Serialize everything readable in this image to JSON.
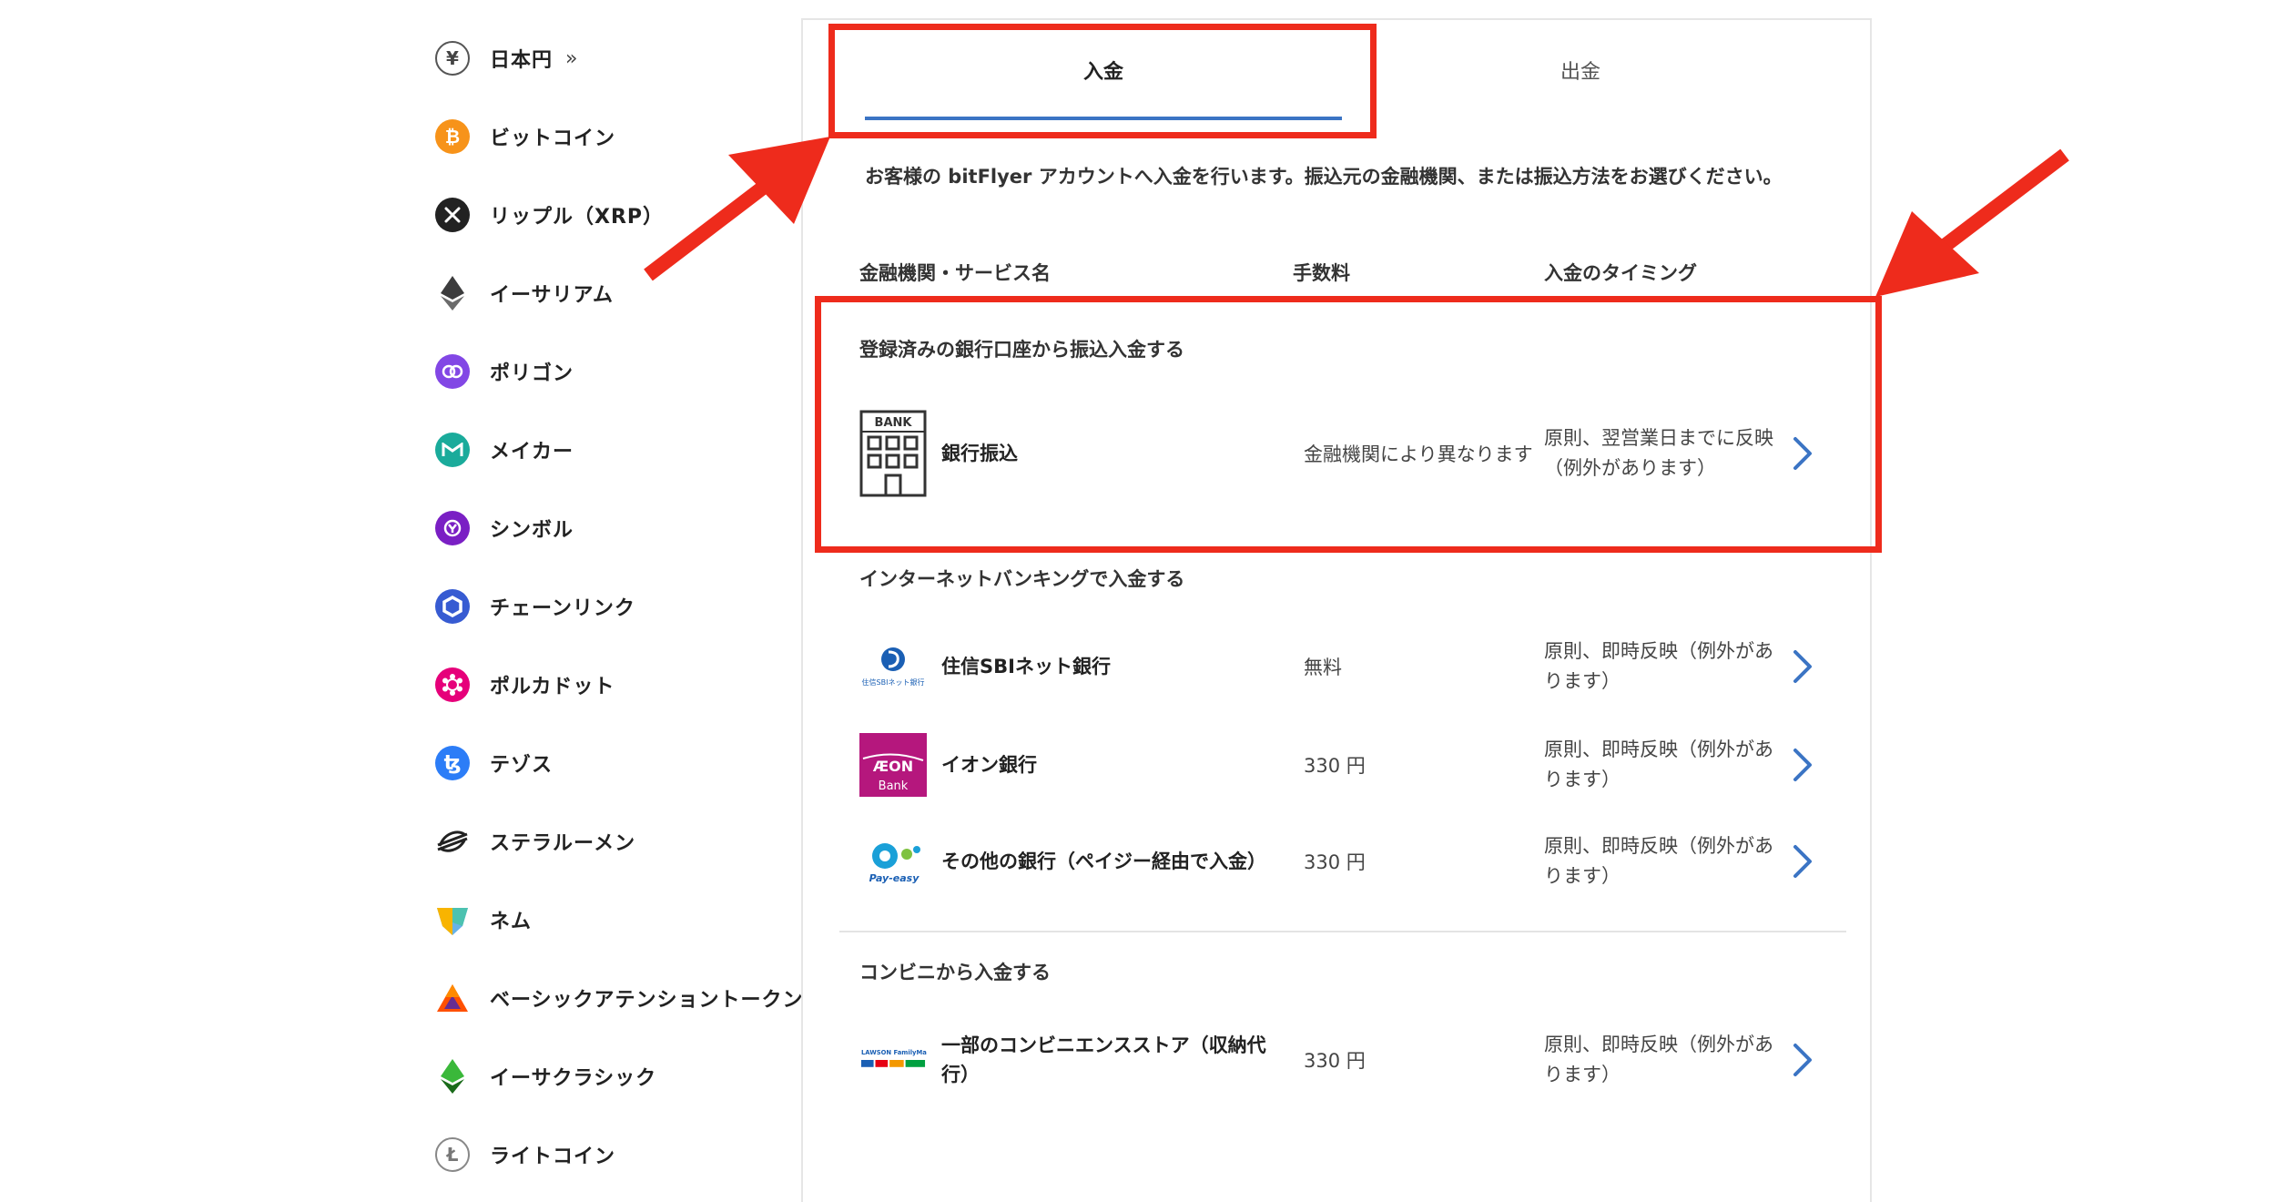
{
  "sidebar": {
    "items": [
      {
        "label": "日本円",
        "icon": "yen-icon",
        "color": "#ffffff"
      },
      {
        "label": "ビットコイン",
        "icon": "bitcoin-icon",
        "color": "#f7931a"
      },
      {
        "label": "リップル（XRP）",
        "icon": "xrp-icon",
        "color": "#222222"
      },
      {
        "label": "イーサリアム",
        "icon": "ethereum-icon",
        "color": "#3c3c3d"
      },
      {
        "label": "ポリゴン",
        "icon": "polygon-icon",
        "color": "#8247e5"
      },
      {
        "label": "メイカー",
        "icon": "maker-icon",
        "color": "#1aab9b"
      },
      {
        "label": "シンボル",
        "icon": "symbol-icon",
        "color": "#7a1fc4"
      },
      {
        "label": "チェーンリンク",
        "icon": "chainlink-icon",
        "color": "#375bd2"
      },
      {
        "label": "ポルカドット",
        "icon": "polkadot-icon",
        "color": "#e6007a"
      },
      {
        "label": "テゾス",
        "icon": "tezos-icon",
        "color": "#2c7df7"
      },
      {
        "label": "ステラルーメン",
        "icon": "stellar-icon",
        "color": "#222222"
      },
      {
        "label": "ネム",
        "icon": "nem-icon",
        "color": "#67b2e8"
      },
      {
        "label": "ベーシックアテンショントークン",
        "icon": "bat-icon",
        "color": "#ff5000"
      },
      {
        "label": "イーサクラシック",
        "icon": "ethereum-classic-icon",
        "color": "#328332"
      },
      {
        "label": "ライトコイン",
        "icon": "litecoin-icon",
        "color": "#888888"
      }
    ],
    "expand_glyph": "»"
  },
  "tabs": {
    "deposit": "入金",
    "withdraw": "出金"
  },
  "intro": "お客様の bitFlyer アカウントへ入金を行います。振込元の金融機関、または振込方法をお選びください。",
  "columns": {
    "name": "金融機関・サービス名",
    "fee": "手数料",
    "timing": "入金のタイミング"
  },
  "sections": {
    "registered": {
      "title": "登録済みの銀行口座から振込入金する",
      "rows": [
        {
          "name": "銀行振込",
          "fee": "金融機関により異なります",
          "timing": "原則、翌営業日までに反映（例外があります）",
          "logo_text": "BANK"
        }
      ]
    },
    "internet": {
      "title": "インターネットバンキングで入金する",
      "rows": [
        {
          "name": "住信SBIネット銀行",
          "fee": "無料",
          "timing": "原則、即時反映（例外があります）",
          "logo_text": "住信SBIネット銀行"
        },
        {
          "name": "イオン銀行",
          "fee": "330 円",
          "timing": "原則、即時反映（例外があります）",
          "logo_text": "ÆON",
          "logo_sub": "Bank"
        },
        {
          "name": "その他の銀行（ペイジー経由で入金）",
          "fee": "330 円",
          "timing": "原則、即時反映（例外があります）",
          "logo_text": "Pay-easy"
        }
      ]
    },
    "convenience": {
      "title": "コンビニから入金する",
      "rows": [
        {
          "name": "一部のコンビニエンスストア（収納代行）",
          "fee": "330 円",
          "timing": "原則、即時反映（例外があります）",
          "logo_text": "LAWSON FamilyMart"
        }
      ]
    }
  },
  "colors": {
    "accent": "#3b74c4",
    "annotation": "#ee2b1c",
    "chevron": "#3b74c4"
  }
}
